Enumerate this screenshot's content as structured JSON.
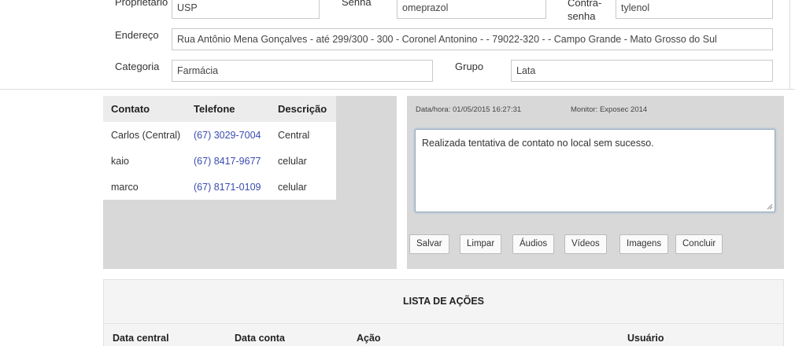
{
  "form": {
    "owner_label": "Proprietário",
    "owner_value": "USP",
    "password_label": "Senha",
    "password_value": "omeprazol",
    "confirm_label_1": "Contra-",
    "confirm_label_2": "senha",
    "confirm_value": "tylenol",
    "address_label": "Endereço",
    "address_value": "Rua Antônio Mena Gonçalves - até 299/300 - 300 - Coronel Antonino -  - 79022-320 -  - Campo Grande - Mato Grosso do Sul",
    "category_label": "Categoria",
    "category_value": "Farmácia",
    "group_label": "Grupo",
    "group_value": "Lata"
  },
  "contacts": {
    "headers": [
      "Contato",
      "Telefone",
      "Descrição"
    ],
    "rows": [
      {
        "name": "Carlos (Central)",
        "phone": "(67) 3029-7004",
        "desc": "Central"
      },
      {
        "name": "kaio",
        "phone": "(67) 8417-9677",
        "desc": "celular"
      },
      {
        "name": "marco",
        "phone": "(67) 8171-0109",
        "desc": "celular"
      }
    ]
  },
  "note": {
    "datetime": "Data/hora: 01/05/2015 16:27:31",
    "monitor": "Monitor: Exposec 2014",
    "text": "Realizada tentativa de contato no local sem sucesso.",
    "buttons": {
      "save": "Salvar",
      "clear": "Limpar",
      "audios": "Áudios",
      "videos": "Vídeos",
      "images": "Imagens",
      "finish": "Concluir"
    }
  },
  "actions": {
    "title": "LISTA DE AÇÕES",
    "columns": [
      "Data central",
      "Data conta",
      "Ação",
      "Usuário"
    ]
  },
  "colors": {
    "panel_bg": "#d8d8d8",
    "link_phone": "#3a4bb0"
  }
}
